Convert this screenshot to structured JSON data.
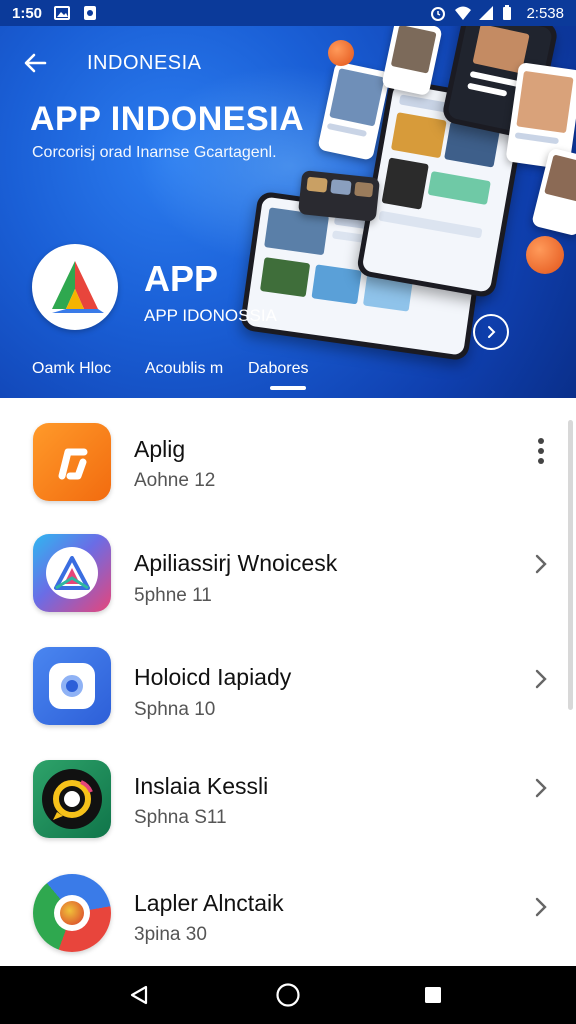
{
  "status_bar": {
    "left_text": "1:50",
    "time": "2:538"
  },
  "header": {
    "title": "INDONESIA"
  },
  "hero": {
    "title": "APP INDONESIA",
    "subtitle": "Corcorisj orad Inarnse Gcartagenl.",
    "app_name": "APP",
    "app_subtitle": "APP IDONOSSIA"
  },
  "tabs": [
    {
      "label": "Oamk Hloc"
    },
    {
      "label": "Acoublis m"
    },
    {
      "label": "Dabores",
      "active": true
    }
  ],
  "list": {
    "items": [
      {
        "title": "Aplig",
        "subtitle": "Aohne 12",
        "icon": "orange-app-icon",
        "action": "more-vert"
      },
      {
        "title": "Apiliassirj Wnoicesk",
        "subtitle": "5phne 11",
        "icon": "triangle-app-icon",
        "action": "chevron-right"
      },
      {
        "title": "Holoicd Iapiady",
        "subtitle": "Sphna 10",
        "icon": "camera-app-icon",
        "action": "chevron-right"
      },
      {
        "title": "Inslaia Kessli",
        "subtitle": "Sphna S11",
        "icon": "chat-app-icon",
        "action": "chevron-right"
      },
      {
        "title": "Lapler Alnctaik",
        "subtitle": "3pina 30",
        "icon": "chrome-app-icon",
        "action": "chevron-right"
      }
    ]
  },
  "colors": {
    "hero_blue": "#1a5fd6",
    "status_bar": "#0b3a9a",
    "orange": "#f7791c",
    "nav_bar": "#000000"
  }
}
